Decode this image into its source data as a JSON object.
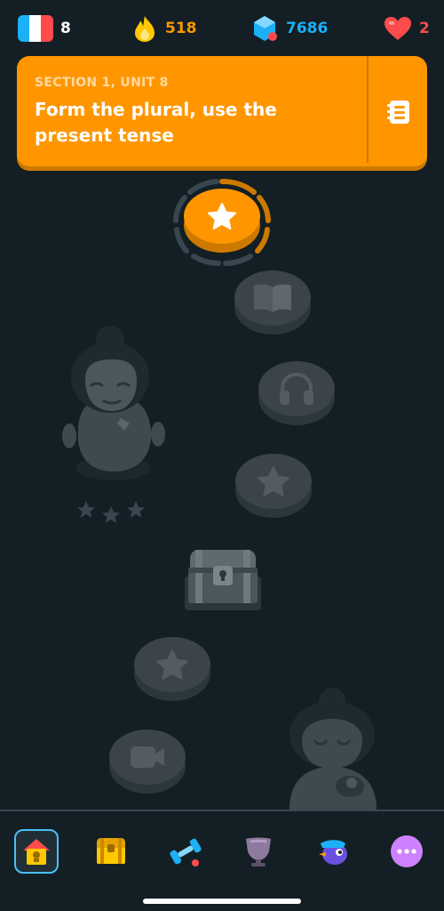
{
  "stats": {
    "language_flag": "france-flag-icon",
    "courses": "8",
    "streak": "518",
    "gems": "7686",
    "hearts": "2"
  },
  "banner": {
    "section": "SECTION 1, UNIT 8",
    "title": "Form the plural, use the present tense",
    "guide_icon": "guidebook-icon"
  },
  "path": {
    "nodes": [
      {
        "icon": "star-icon",
        "state": "current"
      },
      {
        "icon": "book-icon",
        "state": "locked"
      },
      {
        "icon": "headphones-icon",
        "state": "locked"
      },
      {
        "icon": "star-icon",
        "state": "locked"
      },
      {
        "icon": "chest-icon",
        "state": "locked"
      },
      {
        "icon": "star-icon",
        "state": "locked"
      },
      {
        "icon": "video-icon",
        "state": "locked"
      }
    ]
  },
  "nav": {
    "items": [
      "home-icon",
      "chest-icon",
      "dumbbell-icon",
      "shield-icon",
      "bird-icon",
      "more-icon"
    ],
    "active": "home-icon"
  },
  "colors": {
    "background": "#131f24",
    "accent": "#ff9600",
    "accent_dark": "#cd7900",
    "streak": "#ffc800",
    "gems": "#1cb0f6",
    "hearts": "#ff4b4b",
    "nav_active": "#49c0f8"
  }
}
